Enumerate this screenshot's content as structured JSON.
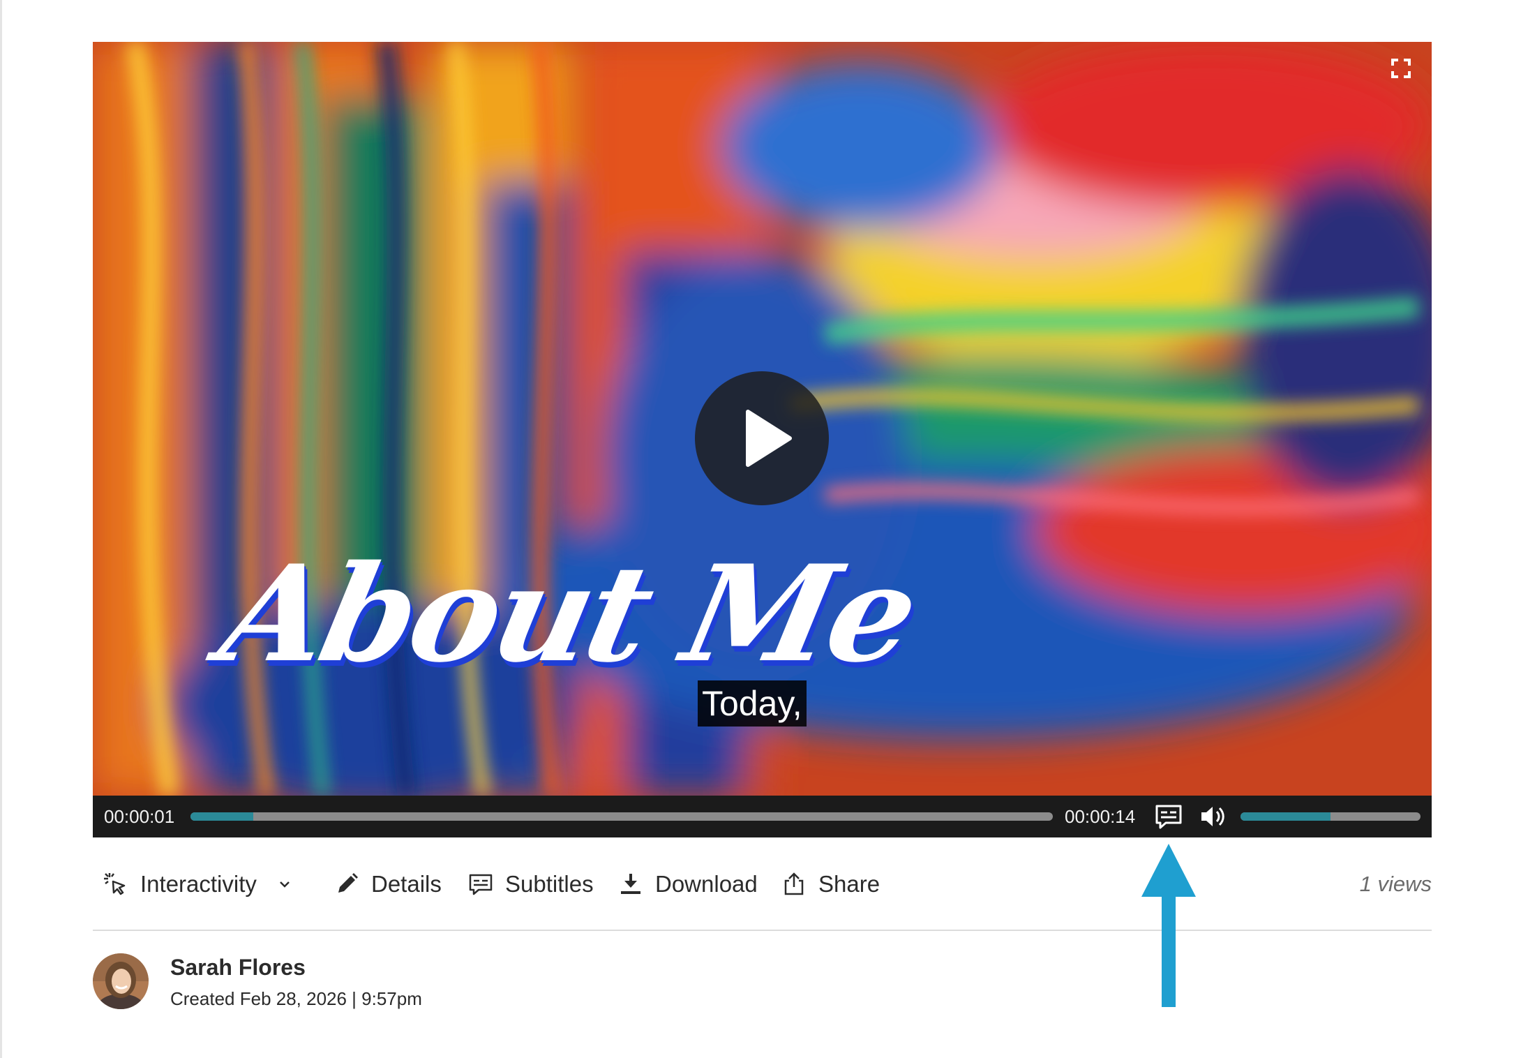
{
  "video": {
    "title_overlay": "About Me",
    "caption": "Today,",
    "current_time": "00:00:01",
    "duration": "00:00:14",
    "progress_fraction": 0.073,
    "volume_fraction": 0.5
  },
  "toolbar": {
    "interactivity_label": "Interactivity",
    "details_label": "Details",
    "subtitles_label": "Subtitles",
    "download_label": "Download",
    "share_label": "Share",
    "views_label": "1 views"
  },
  "author": {
    "name": "Sarah Flores",
    "created": "Created Feb 28, 2026 | 9:57pm"
  },
  "colors": {
    "accent": "#2b8a98",
    "annotation_arrow": "#1f9fd0",
    "title_shadow": "#1f3fd6"
  },
  "icons": [
    "fullscreen-icon",
    "play-icon",
    "closed-captions-icon",
    "volume-icon",
    "cursor-click-icon",
    "pencil-icon",
    "subtitles-icon",
    "download-icon",
    "share-icon",
    "chevron-down-icon"
  ]
}
